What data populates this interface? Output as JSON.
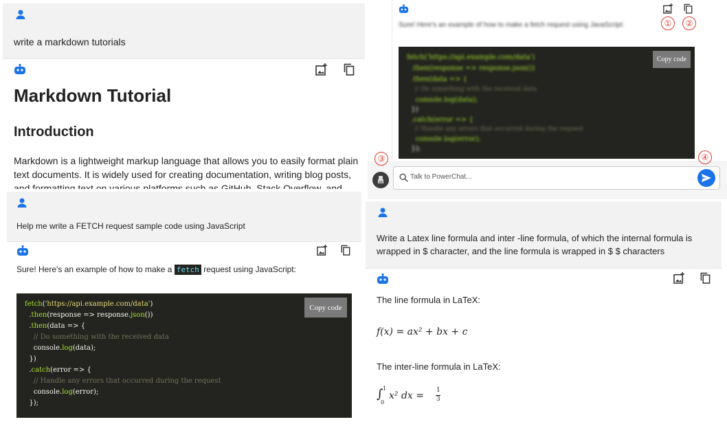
{
  "p1": {
    "user_msg": "write a markdown tutorials",
    "title": "Markdown Tutorial",
    "h2": "Introduction",
    "para1": "Markdown is a lightweight markup language that allows you to easily format plain",
    "para2": "text documents. It is widely used for creating documentation, writing blog posts,",
    "para3": "and formatting text on various platforms such as GitHub, Stack Overflow, and"
  },
  "p2": {
    "user_msg": "Help me write a FETCH request sample code using JavaScript",
    "reply_pre": "Sure! Here's an example of how to make a",
    "reply_code": "fetch",
    "reply_post": "request using JavaScript:",
    "copy_label": "Copy code",
    "code": [
      "fetch('https://api.example.com/data')",
      "  .then(response => response.json())",
      "  .then(data => {",
      "    // Do something with the received data",
      "    console.log(data);",
      "  })",
      "  .catch(error => {",
      "    // Handle any errors that occurred during the request",
      "    console.log(error);",
      "  });"
    ]
  },
  "p3": {
    "reply_blurred": "Sure! Here's an example of how to make a fetch request using JavaScript:",
    "copy_label": "Copy code",
    "code": [
      "fetch('https://api.example.com/data')",
      "  .then(response => response.json())",
      "  .then(data => {",
      "    // Do something with the received data",
      "    console.log(data);",
      "  })",
      "  .catch(error => {",
      "    // Handle any errors that occurred during the request",
      "    console.log(error);",
      "  });"
    ],
    "markers": [
      "①",
      "②",
      "③",
      "④"
    ],
    "input_placeholder": "Talk to PowerChat..."
  },
  "p4": {
    "user_msg_1": "Write a Latex line formula and inter -line formula, of which the internal formula is",
    "user_msg_2": "wrapped in $ character, and the line formula is wrapped in $ $ characters",
    "line_label": "The line formula in LaTeX:",
    "inter_label": "The inter-line formula in LaTeX:",
    "formula1": "f(x) = ax² + bx + c",
    "formula2_int": "∫",
    "formula2_upper": "1",
    "formula2_lower": "0",
    "formula2_body": "x² dx =",
    "formula2_num": "1",
    "formula2_den": "3"
  },
  "colors": {
    "accent": "#1a73e8",
    "marker": "#e03a2c",
    "code_bg": "#23241f",
    "user_bg": "#f2f2f2"
  }
}
